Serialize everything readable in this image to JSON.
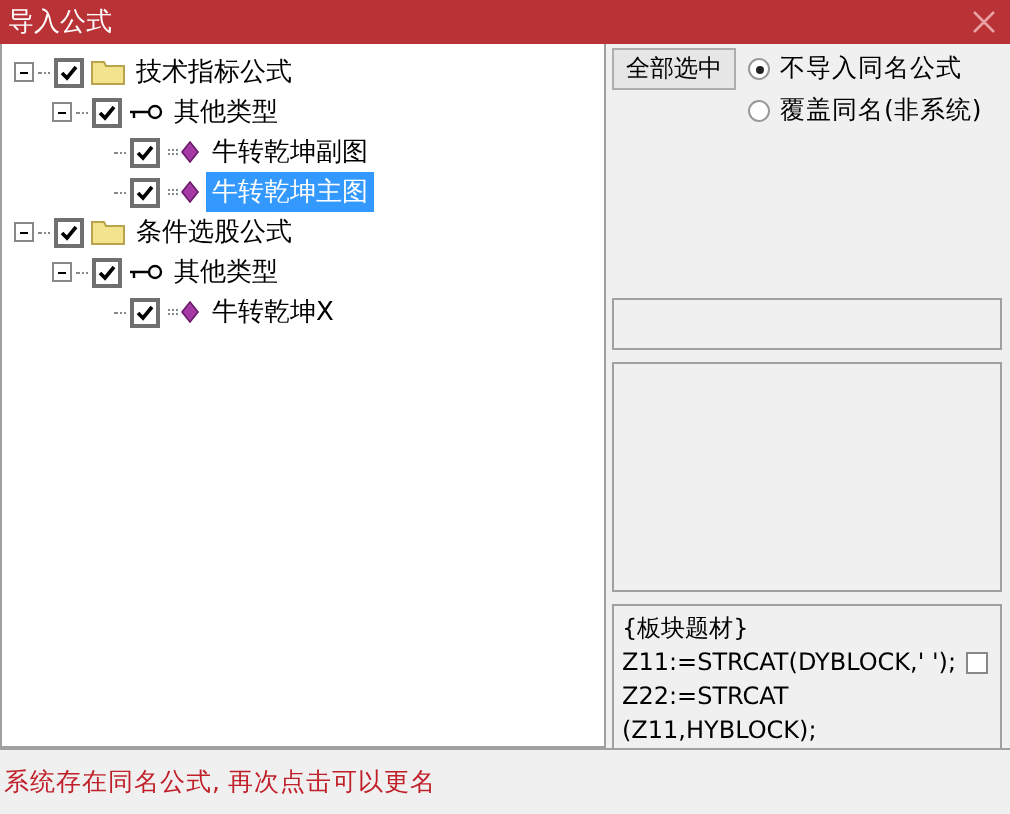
{
  "window": {
    "title": "导入公式"
  },
  "tree": [
    {
      "label": "技术指标公式",
      "kind": "folder",
      "expanded": true,
      "checked": true,
      "selected": false,
      "children": [
        {
          "label": "其他类型",
          "kind": "type",
          "expanded": true,
          "checked": true,
          "selected": false,
          "children": [
            {
              "label": "牛转乾坤副图",
              "kind": "formula",
              "checked": true,
              "selected": false
            },
            {
              "label": "牛转乾坤主图",
              "kind": "formula",
              "checked": true,
              "selected": true
            }
          ]
        }
      ]
    },
    {
      "label": "条件选股公式",
      "kind": "folder",
      "expanded": true,
      "checked": true,
      "selected": false,
      "children": [
        {
          "label": "其他类型",
          "kind": "type",
          "expanded": true,
          "checked": true,
          "selected": false,
          "children": [
            {
              "label": "牛转乾坤X",
              "kind": "formula",
              "checked": true,
              "selected": false
            }
          ]
        }
      ]
    }
  ],
  "select_all_button": "全部选中",
  "options": [
    {
      "label": "不导入同名公式",
      "selected": true
    },
    {
      "label": "覆盖同名(非系统)",
      "selected": false
    }
  ],
  "code": {
    "lines": [
      "{板块题材}",
      "Z11:=STRCAT(DYBLOCK,' ');",
      "Z22:=STRCAT",
      "(Z11,HYBLOCK);"
    ],
    "checked": false
  },
  "status_bar": "系统存在同名公式, 再次点击可以更名"
}
